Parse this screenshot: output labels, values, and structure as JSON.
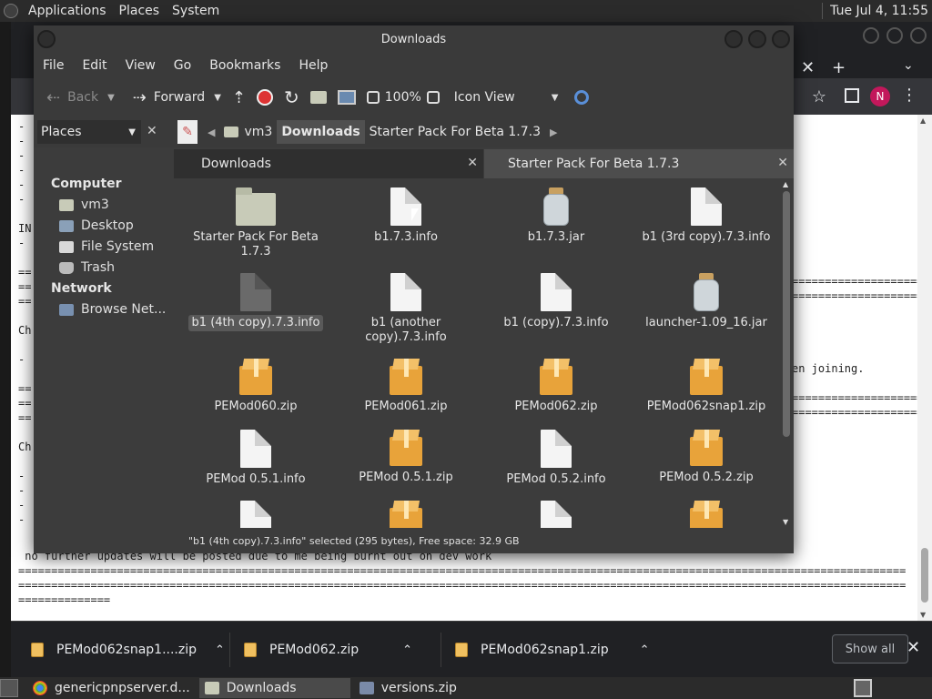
{
  "top_panel": {
    "menus": [
      "Applications",
      "Places",
      "System"
    ],
    "datetime": "Tue Jul  4, 11:55"
  },
  "browser": {
    "page_lines_left": [
      "-",
      "-",
      "-",
      "-",
      "-",
      "-",
      "",
      "IN",
      "-",
      "",
      "==",
      "==",
      "==",
      "",
      "Ch",
      "",
      "-",
      "",
      "==",
      "==",
      "==",
      "",
      "Ch",
      "",
      "-",
      "-",
      "-",
      "-"
    ],
    "page_fragment_join": "en joining.",
    "page_bottom_line": " no further updates will be posted due to me being burnt out on dev work",
    "equals_line": "=======================================================================================================================================",
    "equals_short": "==============",
    "avatar_letter": "N"
  },
  "downloads_bar": {
    "items": [
      {
        "name": "PEMod062snap1....zip"
      },
      {
        "name": "PEMod062.zip"
      },
      {
        "name": "PEMod062snap1.zip"
      }
    ],
    "show_all": "Show all",
    "close": "✕"
  },
  "taskbar": {
    "tasks": [
      {
        "label": "genericpnpserver.d...",
        "icon": "chrome-icon"
      },
      {
        "label": "Downloads",
        "icon": "folder-icon"
      },
      {
        "label": "versions.zip",
        "icon": "archive-icon"
      }
    ]
  },
  "file_manager": {
    "title": "Downloads",
    "menus": [
      "File",
      "Edit",
      "View",
      "Go",
      "Bookmarks",
      "Help"
    ],
    "toolbar": {
      "back": "Back",
      "forward": "Forward",
      "zoom": "100%",
      "view_mode": "Icon View"
    },
    "places_label": "Places",
    "breadcrumbs": [
      "vm3",
      "Downloads",
      "Starter Pack For Beta 1.7.3"
    ],
    "sidebar": {
      "computer_heading": "Computer",
      "computer_items": [
        "vm3",
        "Desktop",
        "File System",
        "Trash"
      ],
      "network_heading": "Network",
      "network_items": [
        "Browse Net..."
      ]
    },
    "tabs": [
      "Downloads",
      "Starter Pack For Beta 1.7.3"
    ],
    "files": [
      {
        "name": "Starter Pack For Beta 1.7.3",
        "kind": "folder"
      },
      {
        "name": "b1.7.3.info",
        "kind": "doc"
      },
      {
        "name": "b1.7.3.jar",
        "kind": "jar"
      },
      {
        "name": "b1 (3rd copy).7.3.info",
        "kind": "doc"
      },
      {
        "name": "b1 (4th copy).7.3.info",
        "kind": "doc-selected"
      },
      {
        "name": "b1 (another copy).7.3.info",
        "kind": "doc"
      },
      {
        "name": "b1 (copy).7.3.info",
        "kind": "doc"
      },
      {
        "name": "launcher-1.09_16.jar",
        "kind": "jar"
      },
      {
        "name": "PEMod060.zip",
        "kind": "zip"
      },
      {
        "name": "PEMod061.zip",
        "kind": "zip"
      },
      {
        "name": "PEMod062.zip",
        "kind": "zip"
      },
      {
        "name": "PEMod062snap1.zip",
        "kind": "zip"
      },
      {
        "name": "PEMod 0.5.1.info",
        "kind": "doc"
      },
      {
        "name": "PEMod 0.5.1.zip",
        "kind": "zip"
      },
      {
        "name": "PEMod 0.5.2.info",
        "kind": "doc"
      },
      {
        "name": "PEMod 0.5.2.zip",
        "kind": "zip"
      }
    ],
    "status": "\"b1 (4th copy).7.3.info\" selected (295 bytes), Free space: 32.9 GB"
  }
}
